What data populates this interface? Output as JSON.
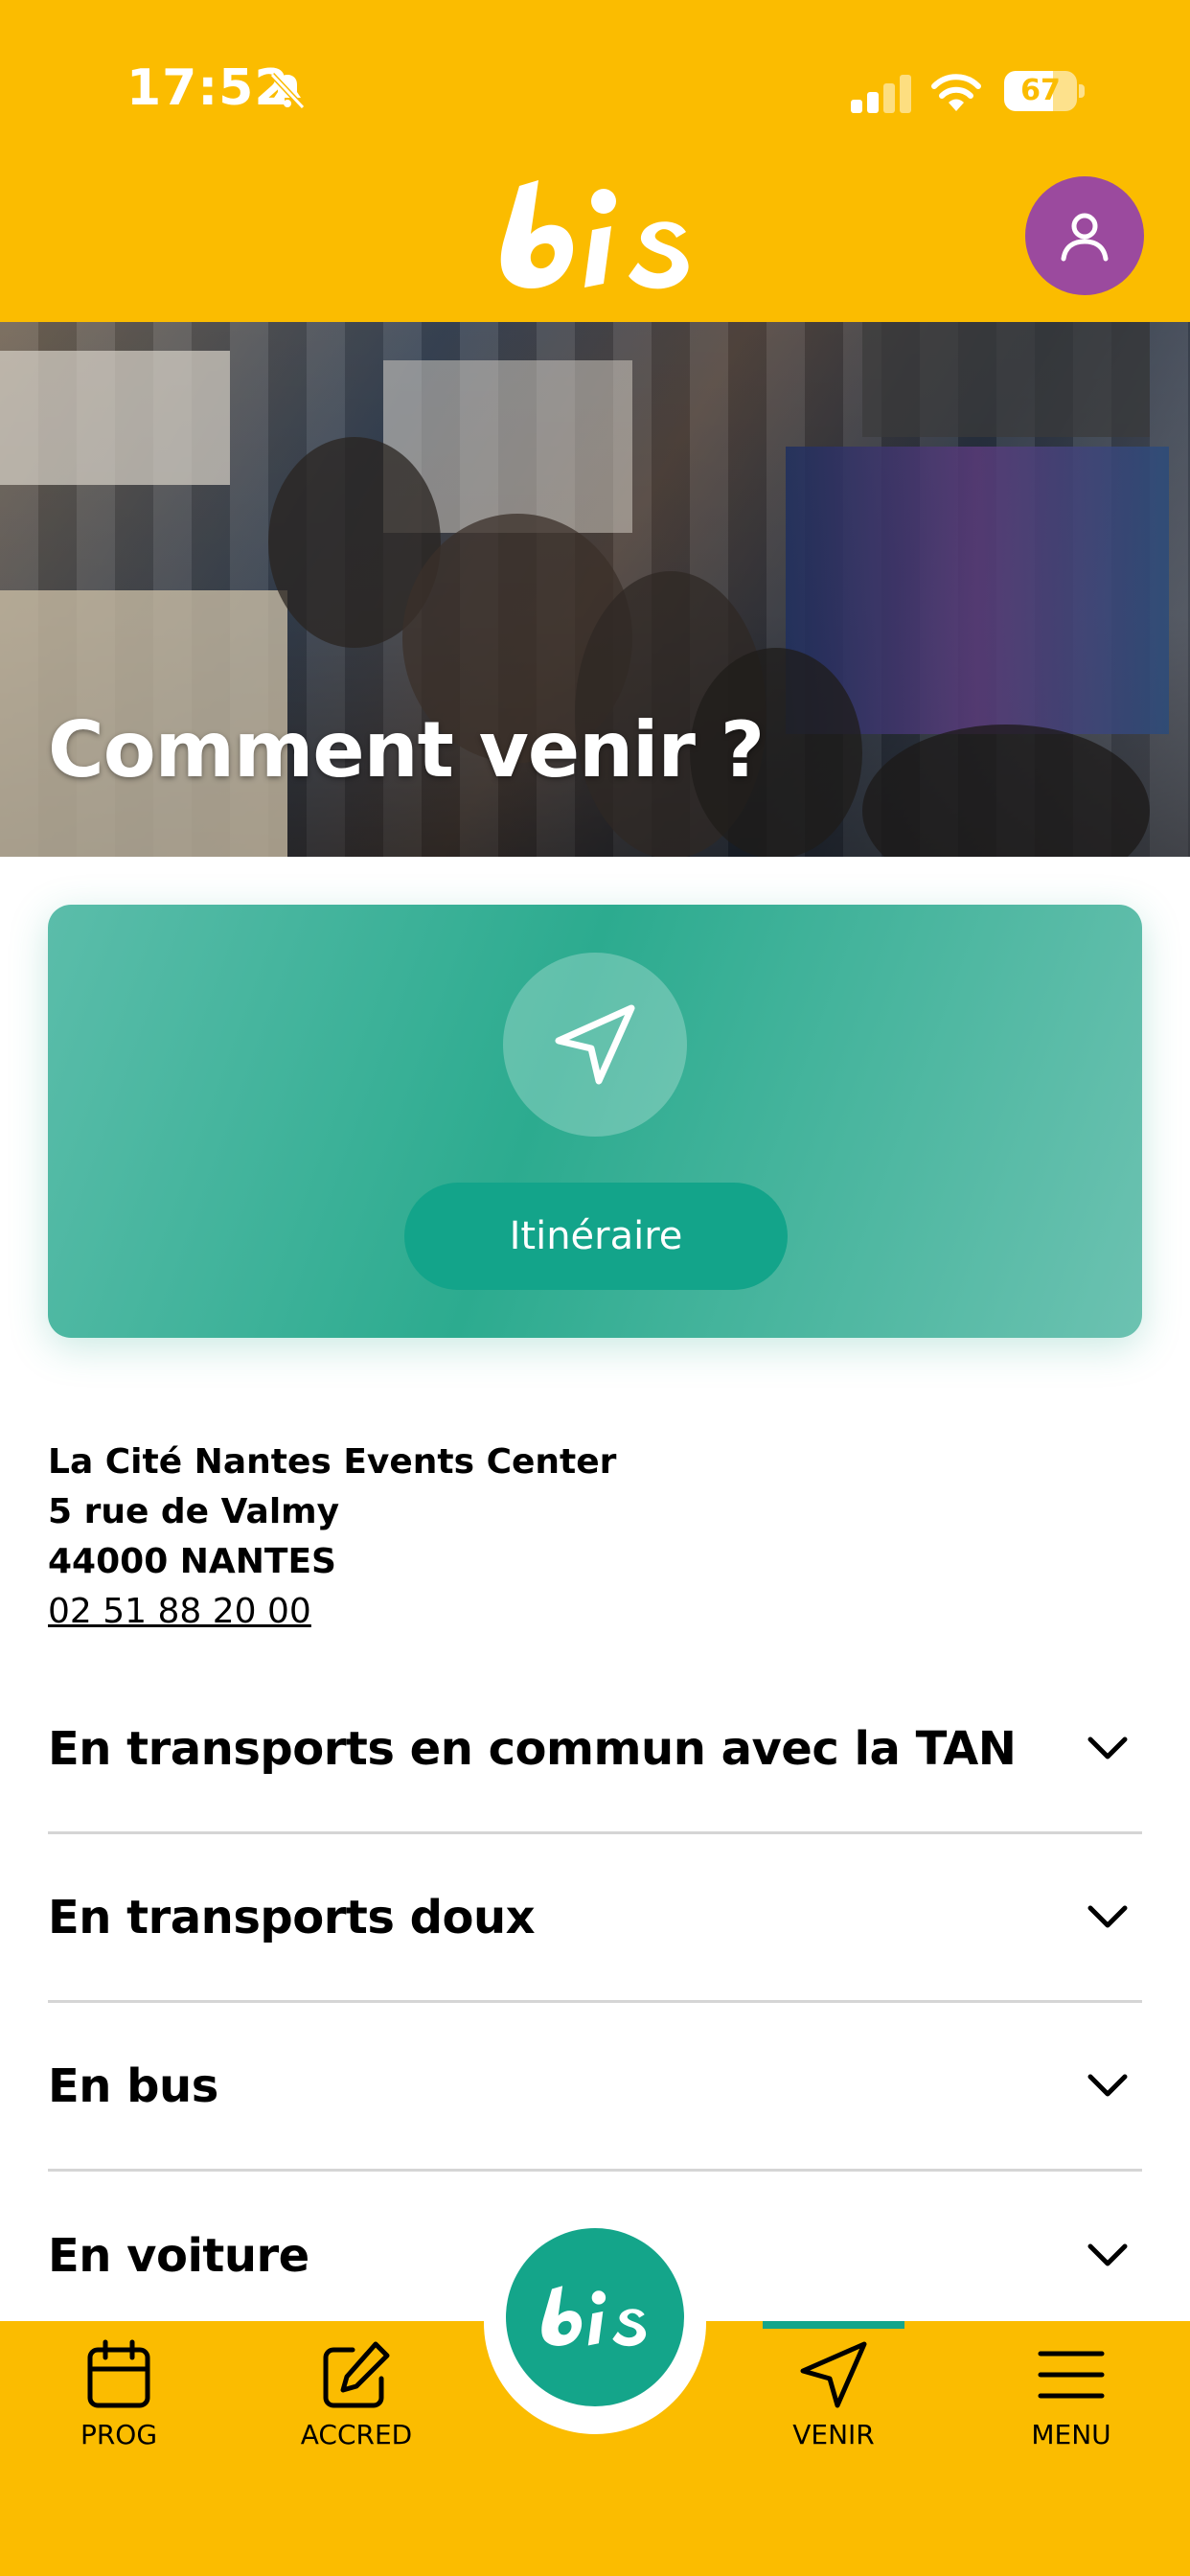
{
  "status_bar": {
    "time": "17:52",
    "battery": "67",
    "battery_level": 0.67
  },
  "header": {
    "logo_text": "bis",
    "profile_icon": "user-icon"
  },
  "hero": {
    "title": "Comment venir ?"
  },
  "itinerary": {
    "icon": "navigation-arrow-icon",
    "button_label": "Itinéraire"
  },
  "address": {
    "line1": "La Cité Nantes Events Center",
    "line2": "5 rue de Valmy",
    "line3": "44000 NANTES",
    "phone": "02 51 88 20 00"
  },
  "sections": [
    {
      "label": "En transports en commun avec la TAN"
    },
    {
      "label": "En transports doux"
    },
    {
      "label": "En bus"
    },
    {
      "label": "En voiture"
    }
  ],
  "bottom_nav": {
    "items": [
      {
        "label": "PROG",
        "icon": "calendar-icon"
      },
      {
        "label": "ACCRED",
        "icon": "edit-icon"
      },
      {
        "label": "VENIR",
        "icon": "navigation-arrow-icon",
        "active": true
      },
      {
        "label": "MENU",
        "icon": "menu-icon"
      }
    ],
    "center_logo": "bis"
  },
  "colors": {
    "brand_yellow": "#FBBC00",
    "brand_green": "#14A58A",
    "avatar_purple": "#9B4A9E"
  }
}
